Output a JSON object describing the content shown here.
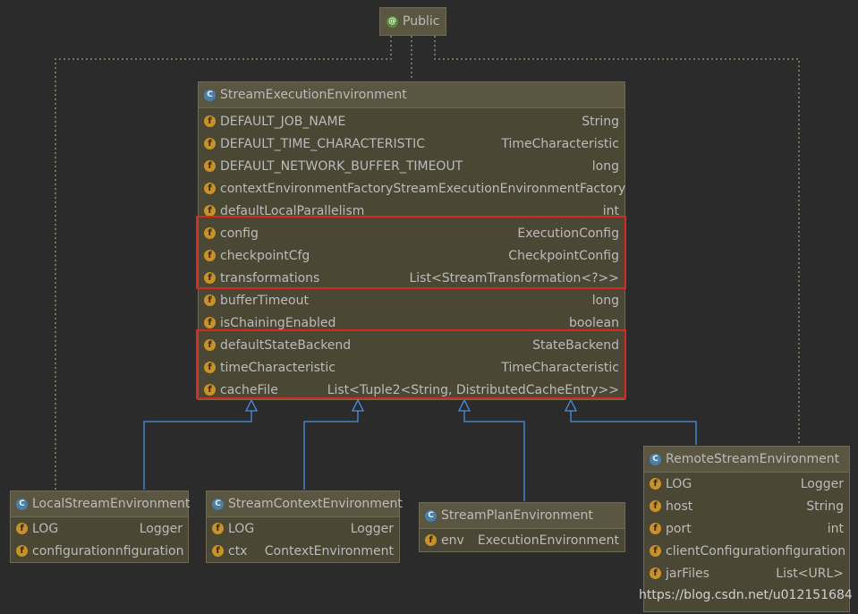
{
  "public_box": {
    "label": "Public",
    "icon": "annotation-icon"
  },
  "main_class": {
    "title": "StreamExecutionEnvironment",
    "fields": [
      {
        "name": "DEFAULT_JOB_NAME",
        "type": "String"
      },
      {
        "name": "DEFAULT_TIME_CHARACTERISTIC",
        "type": "TimeCharacteristic"
      },
      {
        "name": "DEFAULT_NETWORK_BUFFER_TIMEOUT",
        "type": "long"
      },
      {
        "name": "contextEnvironmentFactory",
        "type": "StreamExecutionEnvironmentFactory"
      },
      {
        "name": "defaultLocalParallelism",
        "type": "int"
      },
      {
        "name": "config",
        "type": "ExecutionConfig"
      },
      {
        "name": "checkpointCfg",
        "type": "CheckpointConfig"
      },
      {
        "name": "transformations",
        "type": "List<StreamTransformation<?>>"
      },
      {
        "name": "bufferTimeout",
        "type": "long"
      },
      {
        "name": "isChainingEnabled",
        "type": "boolean"
      },
      {
        "name": "defaultStateBackend",
        "type": "StateBackend"
      },
      {
        "name": "timeCharacteristic",
        "type": "TimeCharacteristic"
      },
      {
        "name": "cacheFile",
        "type": "List<Tuple2<String, DistributedCacheEntry>>"
      }
    ]
  },
  "local_env": {
    "title": "LocalStreamEnvironment",
    "fields": [
      {
        "name": "LOG",
        "type": "Logger"
      },
      {
        "name": "configuration",
        "type": "nfiguration"
      }
    ]
  },
  "context_env": {
    "title": "StreamContextEnvironment",
    "fields": [
      {
        "name": "LOG",
        "type": "Logger"
      },
      {
        "name": "ctx",
        "type": "ContextEnvironment"
      }
    ]
  },
  "plan_env": {
    "title": "StreamPlanEnvironment",
    "fields": [
      {
        "name": "env",
        "type": "ExecutionEnvironment"
      }
    ]
  },
  "remote_env": {
    "title": "RemoteStreamEnvironment",
    "fields": [
      {
        "name": "LOG",
        "type": "Logger"
      },
      {
        "name": "host",
        "type": "String"
      },
      {
        "name": "port",
        "type": "int"
      },
      {
        "name": "clientConfiguration",
        "type": "figuration"
      },
      {
        "name": "jarFiles",
        "type": "List<URL>"
      }
    ]
  },
  "watermark": "https://blog.csdn.net/u012151684",
  "colors": {
    "highlight": "#d62a21",
    "arrow": "#4a8fe0",
    "dotted": "#9a9a70"
  }
}
